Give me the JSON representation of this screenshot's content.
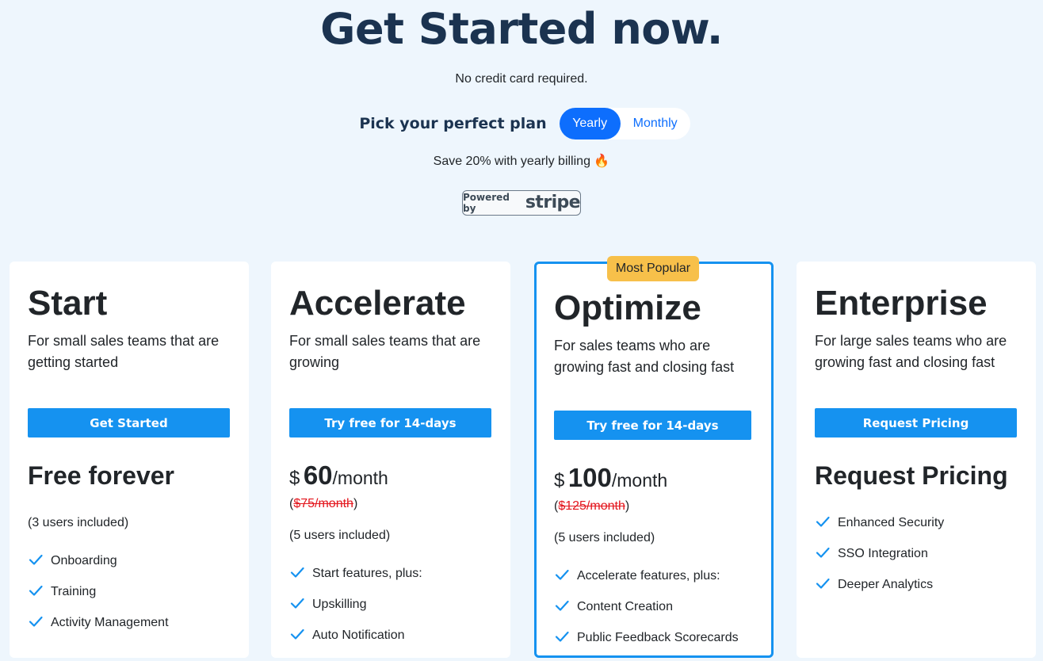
{
  "header": {
    "title": "Get Started now.",
    "subtitle": "No credit card required.",
    "plan_label": "Pick your perfect plan",
    "toggle": {
      "yearly": "Yearly",
      "monthly": "Monthly",
      "selected": "Yearly"
    },
    "save_note": "Save 20% with yearly billing",
    "save_emoji": "🔥",
    "stripe": {
      "powered_by": "Powered by",
      "brand": "stripe"
    }
  },
  "colors": {
    "background": "#eef6fd",
    "title": "#1b3350",
    "primary": "#1592f0",
    "toggle_active": "#0d6efd",
    "badge": "#f7c04a",
    "strike": "#e3161d"
  },
  "plans": [
    {
      "name": "Start",
      "description": "For small sales teams that are getting started",
      "cta": "Get Started",
      "price_heading": "Free forever",
      "users": "(3 users included)",
      "features": [
        "Onboarding",
        "Training",
        "Activity Management"
      ]
    },
    {
      "name": "Accelerate",
      "description": "For small sales teams that are growing",
      "cta": "Try free for 14-days",
      "currency": "$",
      "price": "60",
      "period": "/month",
      "old_price": "$75/month",
      "users": "(5 users included)",
      "features": [
        "Start features, plus:",
        "Upskilling",
        "Auto Notification"
      ]
    },
    {
      "name": "Optimize",
      "badge": "Most Popular",
      "description": "For sales teams who are growing fast and closing fast",
      "cta": "Try free for 14-days",
      "currency": "$",
      "price": "100",
      "period": "/month",
      "old_price": "$125/month",
      "users": "(5 users included)",
      "features": [
        "Accelerate features, plus:",
        "Content Creation",
        "Public Feedback Scorecards"
      ]
    },
    {
      "name": "Enterprise",
      "description": "For large sales teams who are growing fast and closing fast",
      "cta": "Request Pricing",
      "price_heading": "Request Pricing",
      "features": [
        "Enhanced Security",
        "SSO Integration",
        "Deeper Analytics"
      ]
    }
  ]
}
